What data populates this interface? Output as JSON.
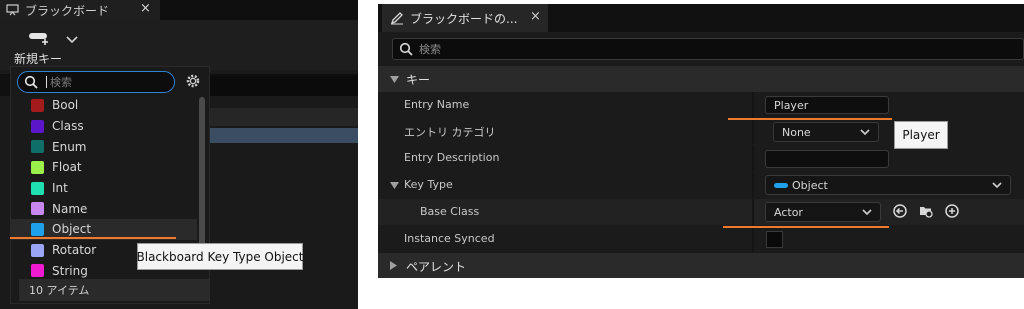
{
  "left_panel": {
    "tab_title": "ブラックボード",
    "tab_close": "×",
    "new_key_label": "新規キー",
    "search_placeholder": "検索",
    "items": [
      {
        "label": "Bool",
        "color": "#a31b1b"
      },
      {
        "label": "Class",
        "color": "#5a16c8"
      },
      {
        "label": "Enum",
        "color": "#0e6f68"
      },
      {
        "label": "Float",
        "color": "#9cf04a"
      },
      {
        "label": "Int",
        "color": "#1fe0b0"
      },
      {
        "label": "Name",
        "color": "#c887ee"
      },
      {
        "label": "Object",
        "color": "#1fa0ea"
      },
      {
        "label": "Rotator",
        "color": "#9aa6f4"
      },
      {
        "label": "String",
        "color": "#f01ad0"
      }
    ],
    "selected_item": "Object",
    "footer": "10 アイテム",
    "tooltip": "Blackboard Key Type Object",
    "icons": [
      "monitor-icon",
      "close-icon",
      "add-key-icon",
      "chevron-down-icon",
      "search-icon",
      "gear-icon"
    ]
  },
  "right_panel": {
    "tab_title": "ブラックボードの...",
    "tab_close": "×",
    "search_placeholder": "検索",
    "section_key": "キー",
    "entry_name_label": "Entry Name",
    "entry_name_value": "Player",
    "entry_category_label": "エントリ カテゴリ",
    "entry_category_value": "None",
    "entry_description_label": "Entry Description",
    "entry_description_value": "",
    "key_type_label": "Key Type",
    "key_type_value": "Object",
    "key_type_color": "#1fa0ea",
    "base_class_label": "Base Class",
    "base_class_value": "Actor",
    "instance_synced_label": "Instance Synced",
    "instance_synced_checked": false,
    "section_parent": "ペアレント",
    "tooltip": "Player",
    "icons": [
      "edit-icon",
      "close-icon",
      "search-icon",
      "use-selected-icon",
      "browse-icon",
      "add-icon"
    ]
  },
  "highlight_color": "#ee7b2c"
}
